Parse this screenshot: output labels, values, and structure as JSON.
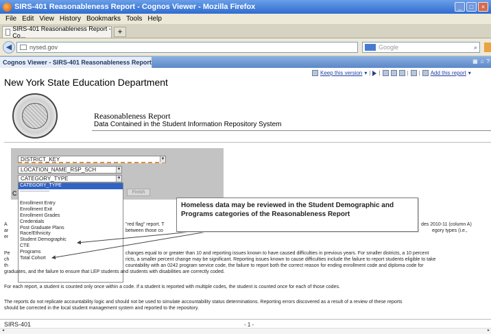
{
  "window": {
    "title": "SIRS-401 Reasonableness Report - Cognos Viewer - Mozilla Firefox"
  },
  "menu": [
    "File",
    "Edit",
    "View",
    "History",
    "Bookmarks",
    "Tools",
    "Help"
  ],
  "tabs": {
    "active_label": "SIRS-401 Reasonableness Report - Co...",
    "new_tab": "+"
  },
  "nav": {
    "url": "nysed.gov",
    "search_placeholder": "Google"
  },
  "cognos": {
    "tab_label": "Cognos Viewer - SIRS-401 Reasonableness Report",
    "toolbar": {
      "keep_version": "Keep this version",
      "add_report": "Add this report"
    }
  },
  "report": {
    "department": "New York State Education Department",
    "title": "Reasonableness Report",
    "subtitle": "Data Contained in the Student Information Repository System"
  },
  "filters": {
    "district": "DISTRICT_KEY",
    "location": "LOCATION_NAME_RSP_SCH",
    "category": "CATEGORY_TYPE",
    "finish_button": "Finish",
    "options": [
      "CATEGORY_TYPE",
      "--------------------------------",
      "",
      "Enrollment Entry",
      "Enrollment Exit",
      "Enrollment Grades",
      "Credentials",
      "Post Graduate Plans",
      "Race/Ethnicity",
      "Student Demographic",
      "CTE",
      "Programs",
      "Total Cohort"
    ]
  },
  "callout": {
    "text": "Homeless data may be reviewed in the Student Demographic and Programs categories of the Reasonableness Report"
  },
  "fragments": {
    "c1": "C",
    "p1a": "A",
    "p1b": "ar",
    "p1c": "er",
    "red_flag": "\"red flag\" report. T",
    "between": "between those co",
    "p1_right": "des 2010-11 (column A)",
    "p1_right2": "egory types (i.e.,",
    "p2a": "Pe",
    "p2b": "ch",
    "p2c": "th",
    "p2_line1": "changes equal to or greater than 10 and reporting issues known to have caused difficulties in previous years. For smaller districts, a 10 percent",
    "p2_line2": "ricts, a smaller percent change may be significant. Reporting issues known to cause difficulties include the failure to report students eligible to take",
    "p2_line3": "countability with an 0242 program service code, the failure to report both the correct reason for ending enrollment code and diploma code for",
    "p2_line4": "graduates, and the failure to ensure that LEP students and students with disabilities are correctly coded."
  },
  "paragraphs": {
    "p3": "For each report, a student is counted only once within a code. If a student is reported with multiple codes, the student is counted once for each of those codes.",
    "p4a": "The reports do not replicate accountability logic and should not be used to simulate accountability status determinations. Reporting errors discovered as a result of a review of these reports",
    "p4b": "should be corrected in the local student management system and reported to the repository."
  },
  "footer": {
    "left": "SIRS-401",
    "page": "- 1 -"
  }
}
